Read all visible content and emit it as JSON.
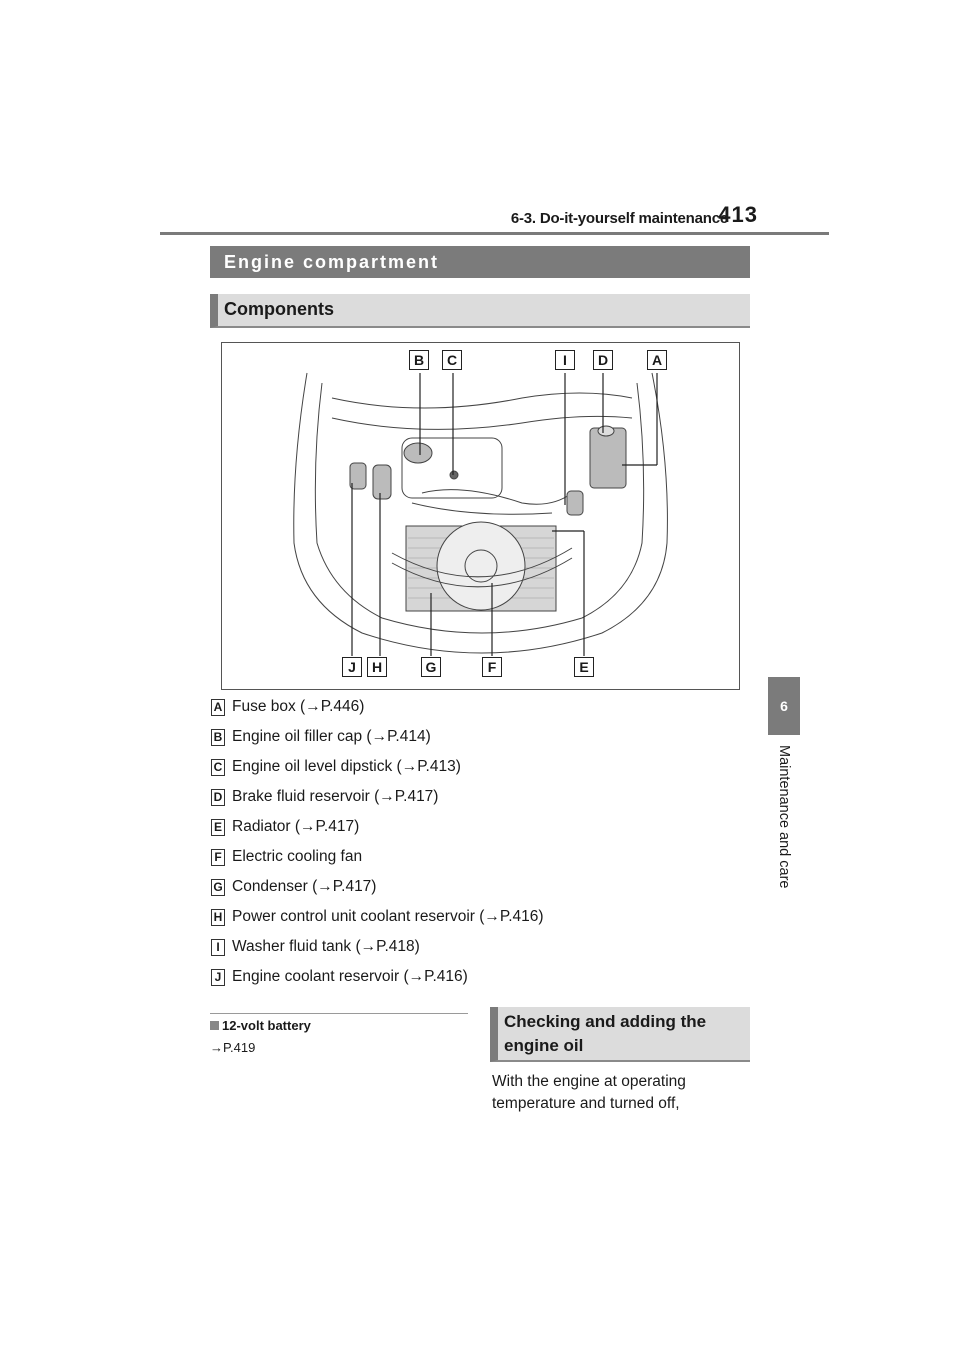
{
  "running_head": {
    "section": "6-3. Do-it-yourself maintenance",
    "page_number": "413"
  },
  "heading": "Engine compartment",
  "subheading": "Components",
  "diagram": {
    "top_callouts": [
      "B",
      "C",
      "I",
      "D",
      "A"
    ],
    "bottom_callouts": [
      "J",
      "H",
      "G",
      "F",
      "E"
    ]
  },
  "components": [
    {
      "letter": "A",
      "text": "Fuse box (→P.446)"
    },
    {
      "letter": "B",
      "text": "Engine oil filler cap (→P.414)"
    },
    {
      "letter": "C",
      "text": "Engine oil level dipstick (→P.413)"
    },
    {
      "letter": "D",
      "text": "Brake fluid reservoir (→P.417)"
    },
    {
      "letter": "E",
      "text": "Radiator (→P.417)"
    },
    {
      "letter": "F",
      "text": "Electric cooling fan"
    },
    {
      "letter": "G",
      "text": "Condenser (→P.417)"
    },
    {
      "letter": "H",
      "text": "Power control unit coolant reservoir (→P.416)"
    },
    {
      "letter": "I",
      "text": "Washer fluid tank (→P.418)"
    },
    {
      "letter": "J",
      "text": "Engine coolant reservoir (→P.416)"
    }
  ],
  "note": {
    "title": "12-volt battery",
    "ref": "→P.419"
  },
  "section2": {
    "heading": "Checking and adding the engine oil",
    "body": "With the engine at operating temperature and turned off,"
  },
  "side_tab": {
    "number": "6",
    "label": "Maintenance and care"
  }
}
